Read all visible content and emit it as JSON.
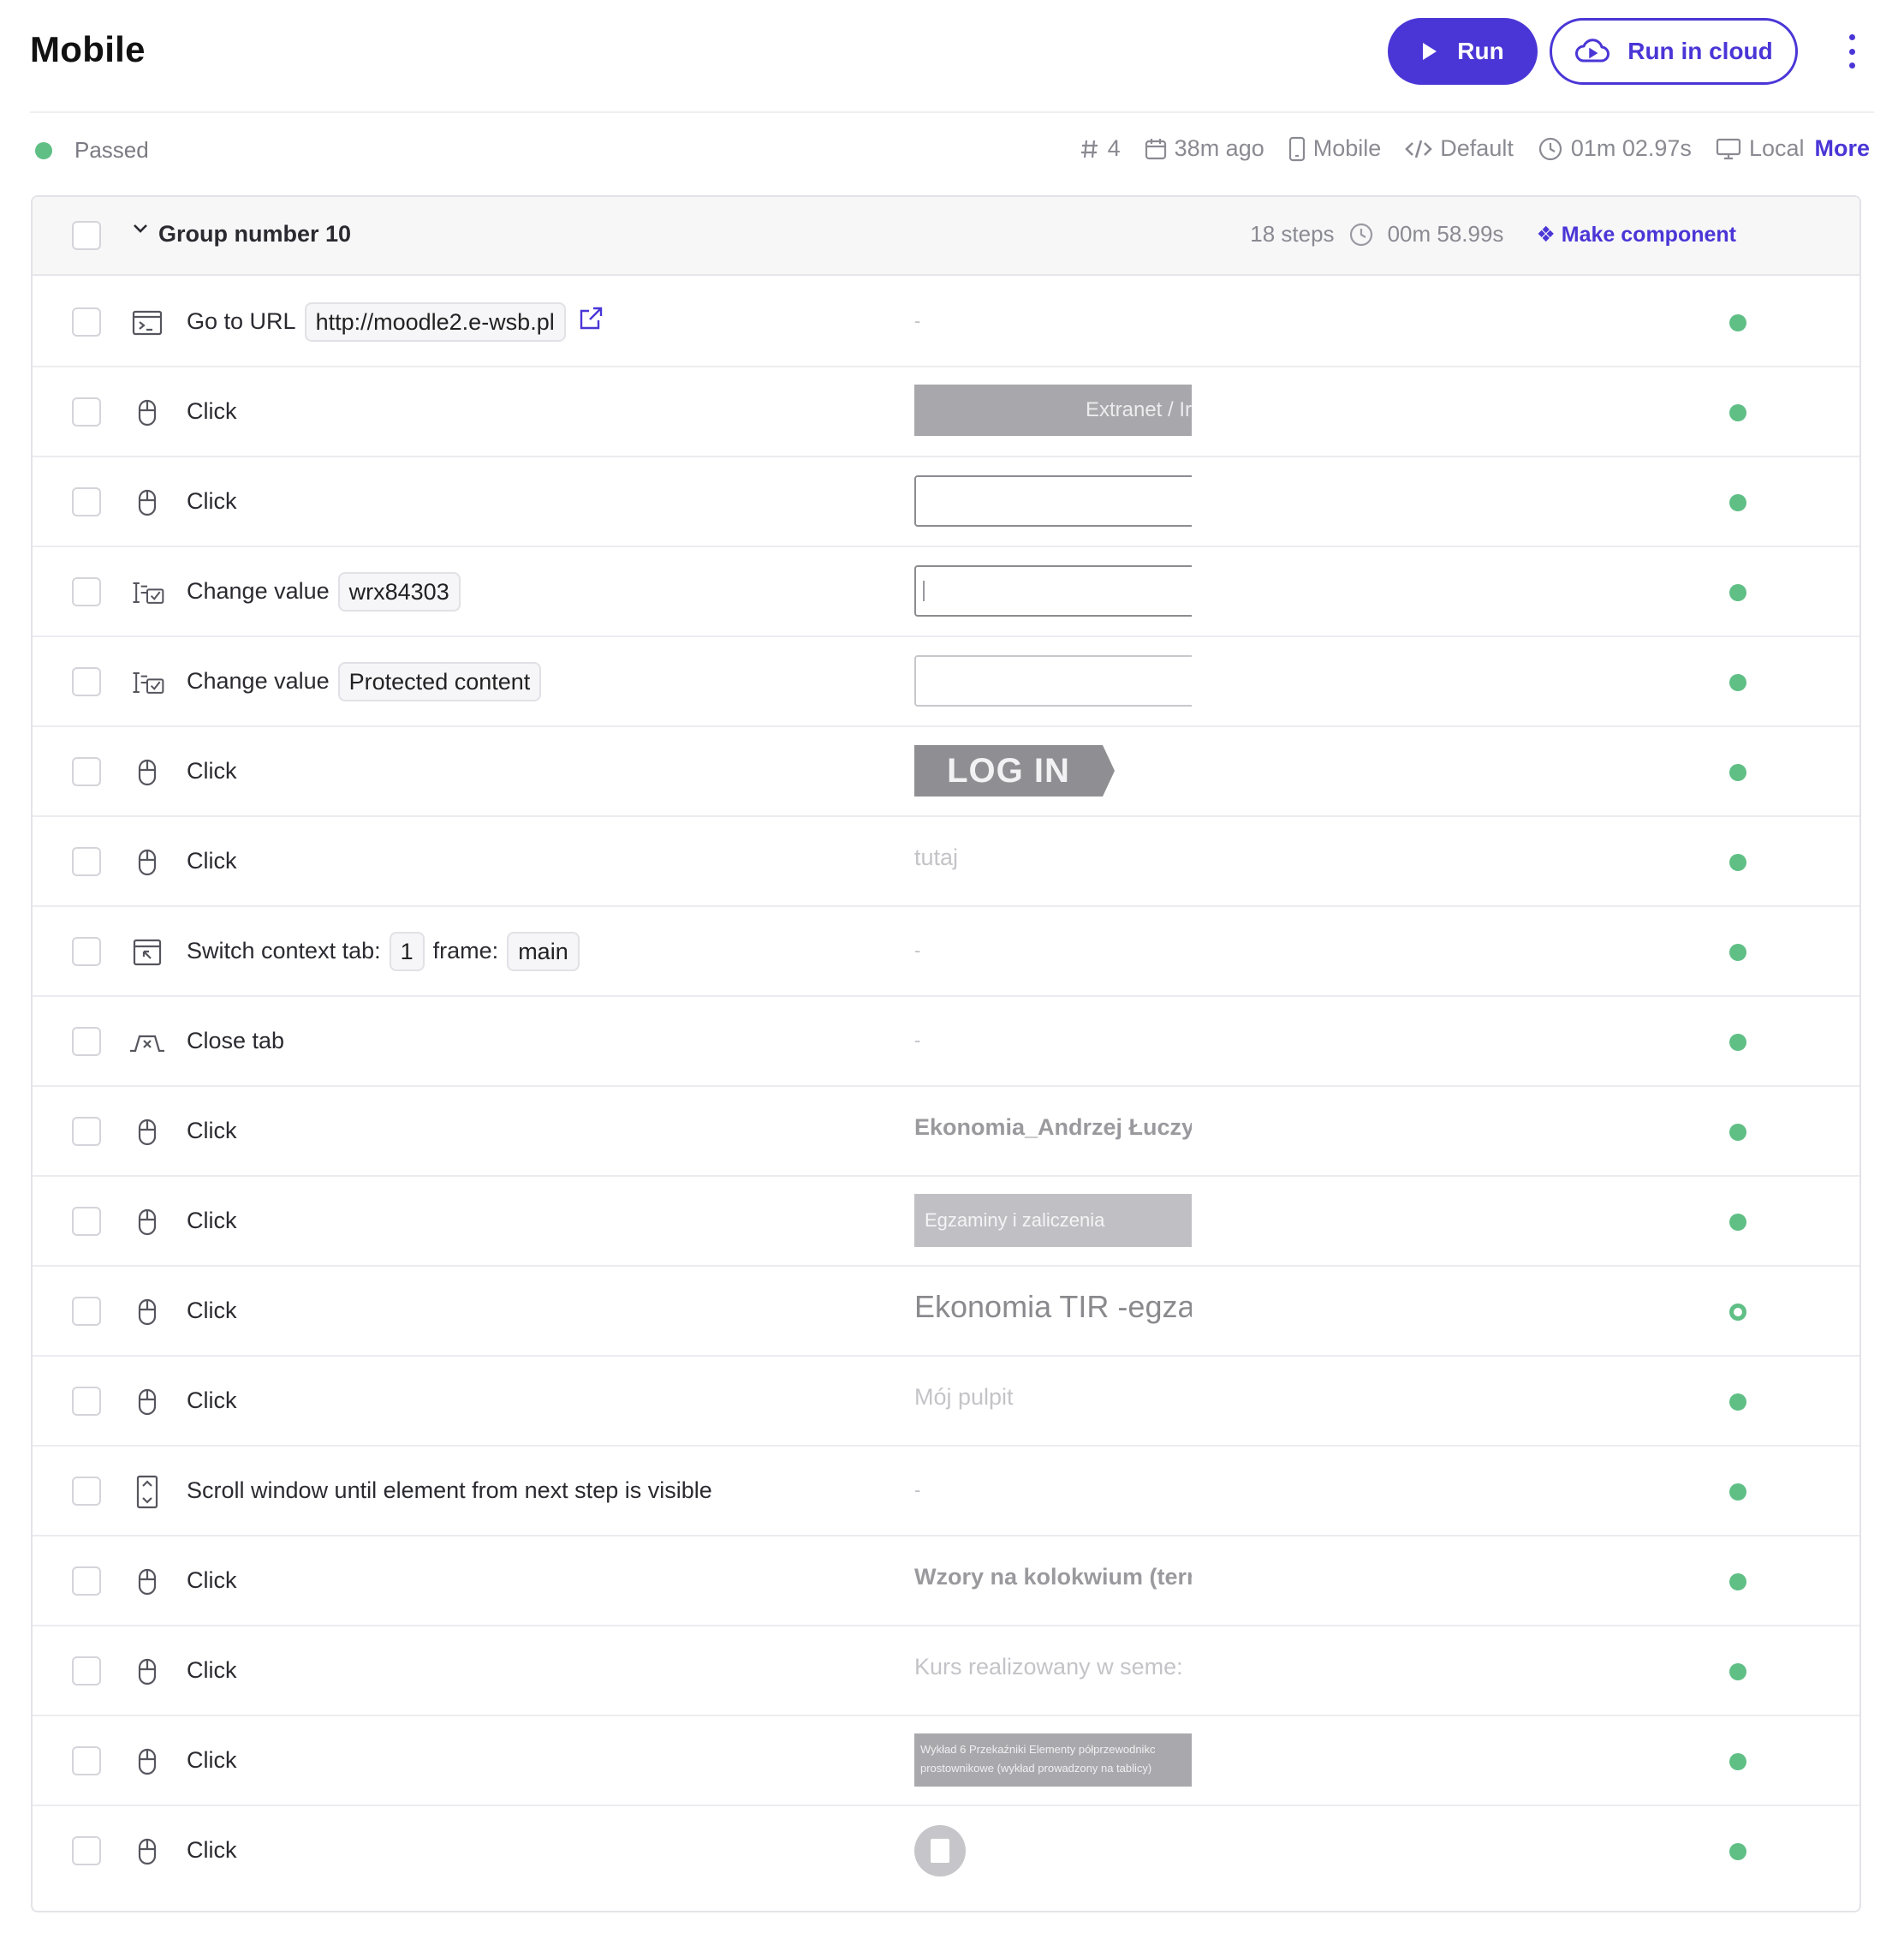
{
  "header": {
    "title": "Mobile",
    "run_label": "Run",
    "run_cloud_label": "Run in cloud"
  },
  "status": {
    "label": "Passed",
    "color": "#5fbf85",
    "run_number": "4",
    "time_ago": "38m ago",
    "device": "Mobile",
    "environment": "Default",
    "duration": "01m 02.97s",
    "location": "Local",
    "more_label": "More"
  },
  "group": {
    "title": "Group number 10",
    "steps_count": "18 steps",
    "duration": "00m 58.99s",
    "make_component_label": "Make component"
  },
  "accent_color": "#4a36d6",
  "steps": [
    {
      "icon": "terminal-icon",
      "action": "Go to URL",
      "params": [
        "http://moodle2.e-wsb.pl"
      ],
      "has_external_link": true,
      "screenshot": {
        "kind": "none",
        "text": "-"
      },
      "status": "passed"
    },
    {
      "icon": "mouse-icon",
      "action": "Click",
      "params": [],
      "screenshot": {
        "kind": "gray-button",
        "text": "Extranet / Ir"
      },
      "status": "passed"
    },
    {
      "icon": "mouse-icon",
      "action": "Click",
      "params": [],
      "screenshot": {
        "kind": "input",
        "text": ""
      },
      "status": "passed"
    },
    {
      "icon": "change-value-icon",
      "action": "Change value",
      "params": [
        "wrx84303"
      ],
      "screenshot": {
        "kind": "input-caret",
        "text": ""
      },
      "status": "passed"
    },
    {
      "icon": "change-value-icon",
      "action": "Change value",
      "params": [
        "Protected content"
      ],
      "screenshot": {
        "kind": "input-light",
        "text": ""
      },
      "status": "passed"
    },
    {
      "icon": "mouse-icon",
      "action": "Click",
      "params": [],
      "screenshot": {
        "kind": "login-button",
        "text": "LOG IN"
      },
      "status": "passed"
    },
    {
      "icon": "mouse-icon",
      "action": "Click",
      "params": [],
      "screenshot": {
        "kind": "text",
        "text": "tutaj"
      },
      "status": "passed"
    },
    {
      "icon": "switch-tab-icon",
      "action": "Switch context tab:",
      "params": [
        "1"
      ],
      "extra_label": "frame:",
      "extra_params": [
        "main"
      ],
      "screenshot": {
        "kind": "none",
        "text": "-"
      },
      "status": "passed"
    },
    {
      "icon": "close-tab-icon",
      "action": "Close tab",
      "params": [],
      "screenshot": {
        "kind": "none",
        "text": "-"
      },
      "status": "passed"
    },
    {
      "icon": "mouse-icon",
      "action": "Click",
      "params": [],
      "screenshot": {
        "kind": "text-bold",
        "text": "Ekonomia_Andrzej Łuczy:"
      },
      "status": "passed"
    },
    {
      "icon": "mouse-icon",
      "action": "Click",
      "params": [],
      "screenshot": {
        "kind": "gray-banner",
        "text": "Egzaminy i zaliczenia"
      },
      "status": "passed"
    },
    {
      "icon": "mouse-icon",
      "action": "Click",
      "params": [],
      "screenshot": {
        "kind": "text-big",
        "text": "Ekonomia TIR -egzai"
      },
      "status": "warning"
    },
    {
      "icon": "mouse-icon",
      "action": "Click",
      "params": [],
      "screenshot": {
        "kind": "text",
        "text": "Mój pulpit"
      },
      "status": "passed"
    },
    {
      "icon": "scroll-icon",
      "action": "Scroll window until element from next step is visible",
      "params": [],
      "screenshot": {
        "kind": "none",
        "text": "-"
      },
      "status": "passed"
    },
    {
      "icon": "mouse-icon",
      "action": "Click",
      "params": [],
      "screenshot": {
        "kind": "text-bold",
        "text": "Wzory na kolokwium (terr"
      },
      "status": "passed"
    },
    {
      "icon": "mouse-icon",
      "action": "Click",
      "params": [],
      "screenshot": {
        "kind": "text",
        "text": "Kurs realizowany w seme:"
      },
      "status": "passed"
    },
    {
      "icon": "mouse-icon",
      "action": "Click",
      "params": [],
      "screenshot": {
        "kind": "small-text",
        "text": "Wykład 6 Przekaźniki Elementy półprzewodnikc",
        "text2": "prostownikowe (wykład prowadzony na tablicy)"
      },
      "status": "passed"
    },
    {
      "icon": "mouse-icon",
      "action": "Click",
      "params": [],
      "screenshot": {
        "kind": "doc-icon",
        "text": ""
      },
      "status": "passed"
    }
  ]
}
